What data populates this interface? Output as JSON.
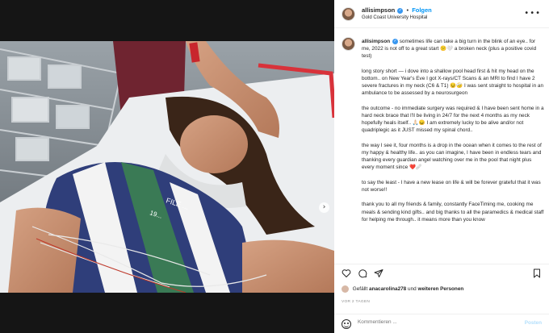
{
  "header": {
    "username": "allisimpson",
    "separator": "•",
    "follow_label": "Folgen",
    "location": "Gold Coast University Hospital",
    "more_icon": "more-horizontal-icon"
  },
  "caption": {
    "username": "allisimpson",
    "paragraphs": [
      "sometimes life can take a big turn in the blink of an eye.. for me, 2022 is not off to a great start 😕🤍 a broken neck (plus a positive covid test)",
      "long story short — i dove into a shallow pool head first & hit my head on the bottom.. on New Year's Eve I got X-rays/CT Scans & an MRI to find I have 2 severe fractures in my neck (C6 & T1) 😣🤕 I was sent straight to hospital in an ambulance to be assessed by a neurosurgeon",
      "the outcome - no immediate surgery was required & I have been sent home in a hard neck brace that I'll be living in 24/7 for the next 4 months as my neck hopefully heals itself.. 🙏🏻😖 I am extremely lucky to be alive and/or not quadriplegic as it JUST missed my spinal chord..",
      "the way I see it, four months is a drop in the ocean when it comes to the rest of my happy & healthy life.. as you can imagine, I have been in endless tears and thanking every guardian angel watching over me in the pool that night plus every moment since ❤️🩹",
      "to say the least - I have a new lease on life & will be forever grateful that it was not worse!!",
      "thank you to all my friends & family, constantly FaceTiming me, cooking me meals & sending kind gifts.. and big thanks to all the paramedics & medical staff for helping me through.. it means more than you know"
    ]
  },
  "actions": {
    "like_icon": "heart-icon",
    "comment_icon": "comment-icon",
    "share_icon": "send-icon",
    "save_icon": "bookmark-icon"
  },
  "likes": {
    "prefix": "Gefällt",
    "user": "anacarolina278",
    "conjunction": "und",
    "others": "weiteren Personen"
  },
  "date": "VOR 2 TAGEN",
  "comment_bar": {
    "placeholder": "Kommentieren ...",
    "post_label": "Posten"
  },
  "media": {
    "next_label": "›",
    "shirt_text_1": "FILE ...",
    "shirt_text_2": "19..."
  },
  "colors": {
    "verified": "#3897f0",
    "follow": "#0095f6",
    "post_disabled": "#b2dffc",
    "backdrop": "#151515"
  }
}
